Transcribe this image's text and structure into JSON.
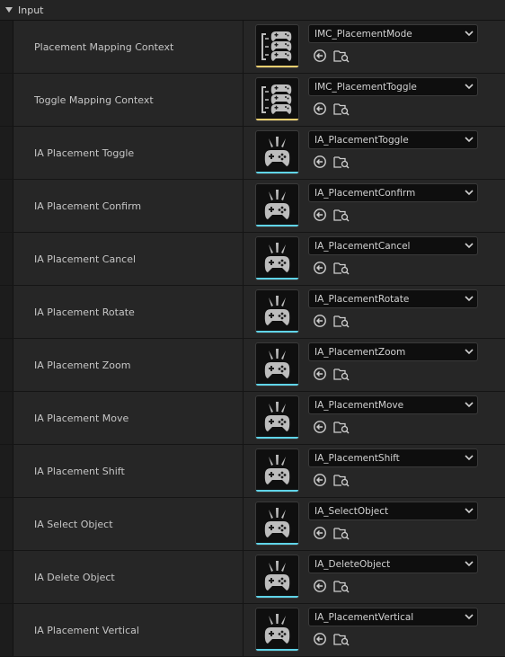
{
  "section": {
    "title": "Input"
  },
  "colors": {
    "context_bar": "#f0d070",
    "action_bar": "#5fd4e8"
  },
  "rows": [
    {
      "label": "Placement Mapping Context",
      "value": "IMC_PlacementMode",
      "kind": "context"
    },
    {
      "label": "Toggle Mapping Context",
      "value": "IMC_PlacementToggle",
      "kind": "context"
    },
    {
      "label": "IA Placement Toggle",
      "value": "IA_PlacementToggle",
      "kind": "action"
    },
    {
      "label": "IA Placement Confirm",
      "value": "IA_PlacementConfirm",
      "kind": "action"
    },
    {
      "label": "IA Placement Cancel",
      "value": "IA_PlacementCancel",
      "kind": "action"
    },
    {
      "label": "IA Placement Rotate",
      "value": "IA_PlacementRotate",
      "kind": "action"
    },
    {
      "label": "IA Placement Zoom",
      "value": "IA_PlacementZoom",
      "kind": "action"
    },
    {
      "label": "IA Placement Move",
      "value": "IA_PlacementMove",
      "kind": "action"
    },
    {
      "label": "IA Placement Shift",
      "value": "IA_PlacementShift",
      "kind": "action"
    },
    {
      "label": "IA Select Object",
      "value": "IA_SelectObject",
      "kind": "action"
    },
    {
      "label": "IA Delete Object",
      "value": "IA_DeleteObject",
      "kind": "action"
    },
    {
      "label": "IA Placement Vertical",
      "value": "IA_PlacementVertical",
      "kind": "action"
    }
  ]
}
